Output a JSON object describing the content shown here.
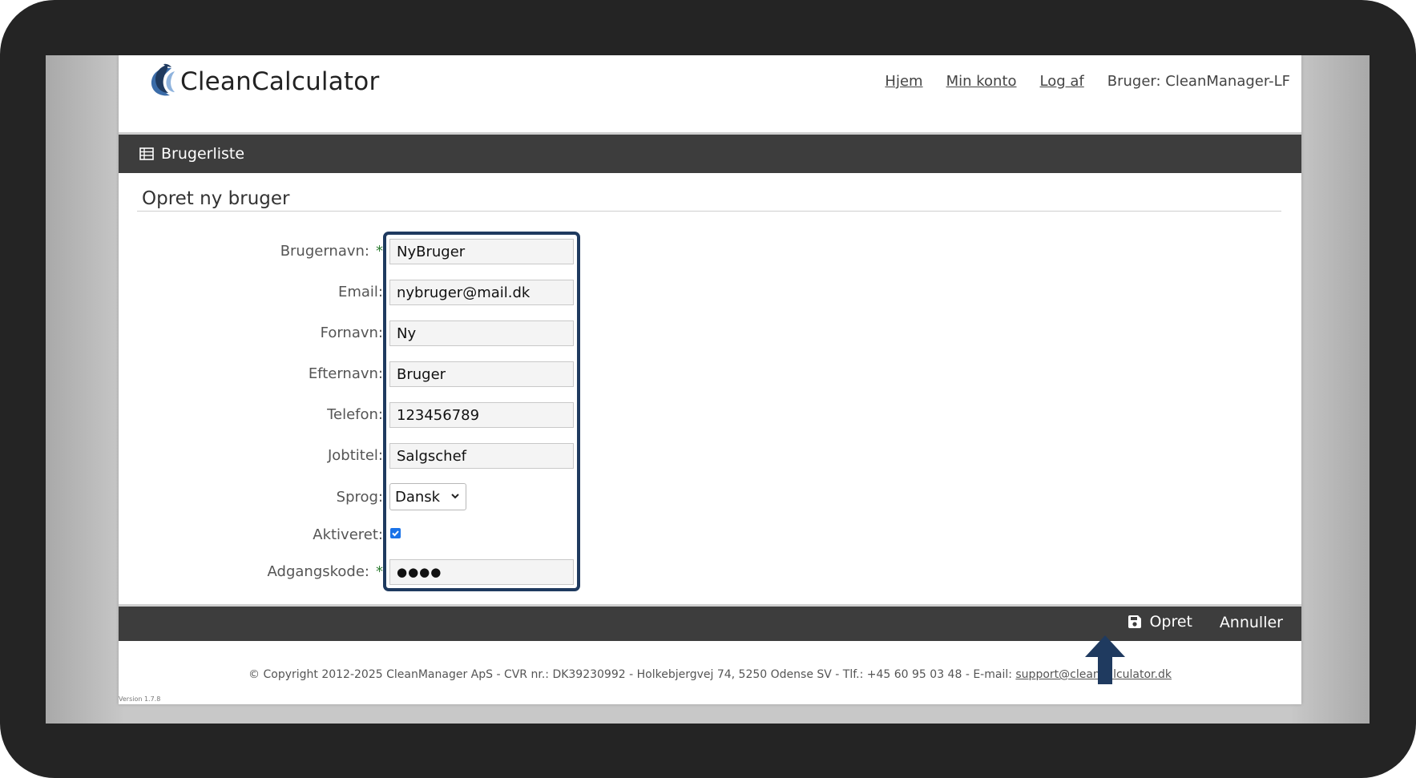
{
  "app": {
    "logo_text": "CleanCalculator",
    "accent_color": "#1f3a5f"
  },
  "topnav": {
    "home": "Hjem",
    "account": "Min konto",
    "logout": "Log af",
    "user": "Bruger: CleanManager-LF"
  },
  "toolbar": {
    "user_list": "Brugerliste",
    "user_list_icon": "table-icon"
  },
  "page": {
    "title": "Opret ny bruger"
  },
  "form": {
    "username": {
      "label": "Brugernavn:",
      "required": "*",
      "value": "NyBruger"
    },
    "email": {
      "label": "Email:",
      "value": "nybruger@mail.dk"
    },
    "first_name": {
      "label": "Fornavn:",
      "value": "Ny"
    },
    "last_name": {
      "label": "Efternavn:",
      "value": "Bruger"
    },
    "phone": {
      "label": "Telefon:",
      "value": "123456789"
    },
    "job_title": {
      "label": "Jobtitel:",
      "value": "Salgschef"
    },
    "language": {
      "label": "Sprog:",
      "value": "Dansk"
    },
    "active": {
      "label": "Aktiveret:",
      "checked": true
    },
    "password": {
      "label": "Adgangskode:",
      "required": "*",
      "value": "●●●●"
    }
  },
  "actions": {
    "create": "Opret",
    "create_icon": "save-icon",
    "cancel": "Annuller"
  },
  "footer": {
    "copyright": "© Copyright 2012-2025 CleanManager ApS - CVR nr.: DK39230992 - Holkebjergvej 74, 5250 Odense SV - Tlf.: +45 60 95 03 48 - E-mail: ",
    "email_link": "support@cleancalculator.dk",
    "version": "Version 1.7.8"
  }
}
